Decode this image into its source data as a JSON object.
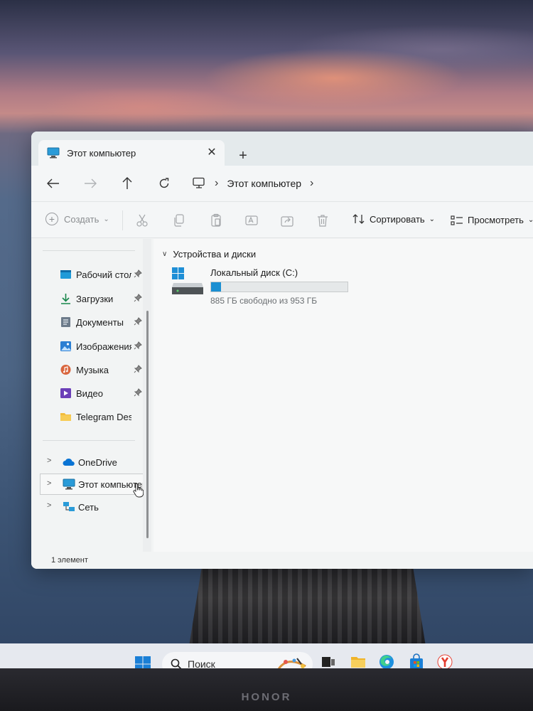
{
  "window": {
    "tab_title": "Этот компьютер",
    "tab_close": "✕",
    "tab_add": "+"
  },
  "address": {
    "sep1": "›",
    "path": "Этот компьютер",
    "sep2": "›"
  },
  "toolbar": {
    "create_label": "Создать",
    "create_caret": "⌄",
    "sort_label": "Сортировать",
    "sort_caret": "⌄",
    "view_label": "Просмотреть",
    "view_caret": "⌄"
  },
  "sidebar": {
    "quick_access": [
      {
        "label": "Рабочий стол",
        "icon": "desktop-icon",
        "pinned": true
      },
      {
        "label": "Загрузки",
        "icon": "downloads-icon",
        "pinned": true
      },
      {
        "label": "Документы",
        "icon": "documents-icon",
        "pinned": true
      },
      {
        "label": "Изображения",
        "icon": "pictures-icon",
        "pinned": true
      },
      {
        "label": "Музыка",
        "icon": "music-icon",
        "pinned": true
      },
      {
        "label": "Видео",
        "icon": "videos-icon",
        "pinned": true
      },
      {
        "label": "Telegram Desktop",
        "icon": "folder-icon",
        "pinned": false
      }
    ],
    "roots": [
      {
        "label": "OneDrive",
        "icon": "cloud-icon",
        "chevron": ">"
      },
      {
        "label": "Этот компьютер",
        "icon": "computer-icon",
        "chevron": ">"
      },
      {
        "label": "Сеть",
        "icon": "network-icon",
        "chevron": ">"
      }
    ]
  },
  "content": {
    "group_title": "Устройства и диски",
    "drive": {
      "name": "Локальный диск (C:)",
      "free_text": "885 ГБ свободно из 953 ГБ",
      "used_fraction": 0.071,
      "bar_color": "#1b8fd2"
    }
  },
  "status": {
    "items_text": "1 элемент"
  },
  "taskbar": {
    "search_placeholder": "Поиск"
  },
  "device": {
    "brand": "HONOR"
  }
}
